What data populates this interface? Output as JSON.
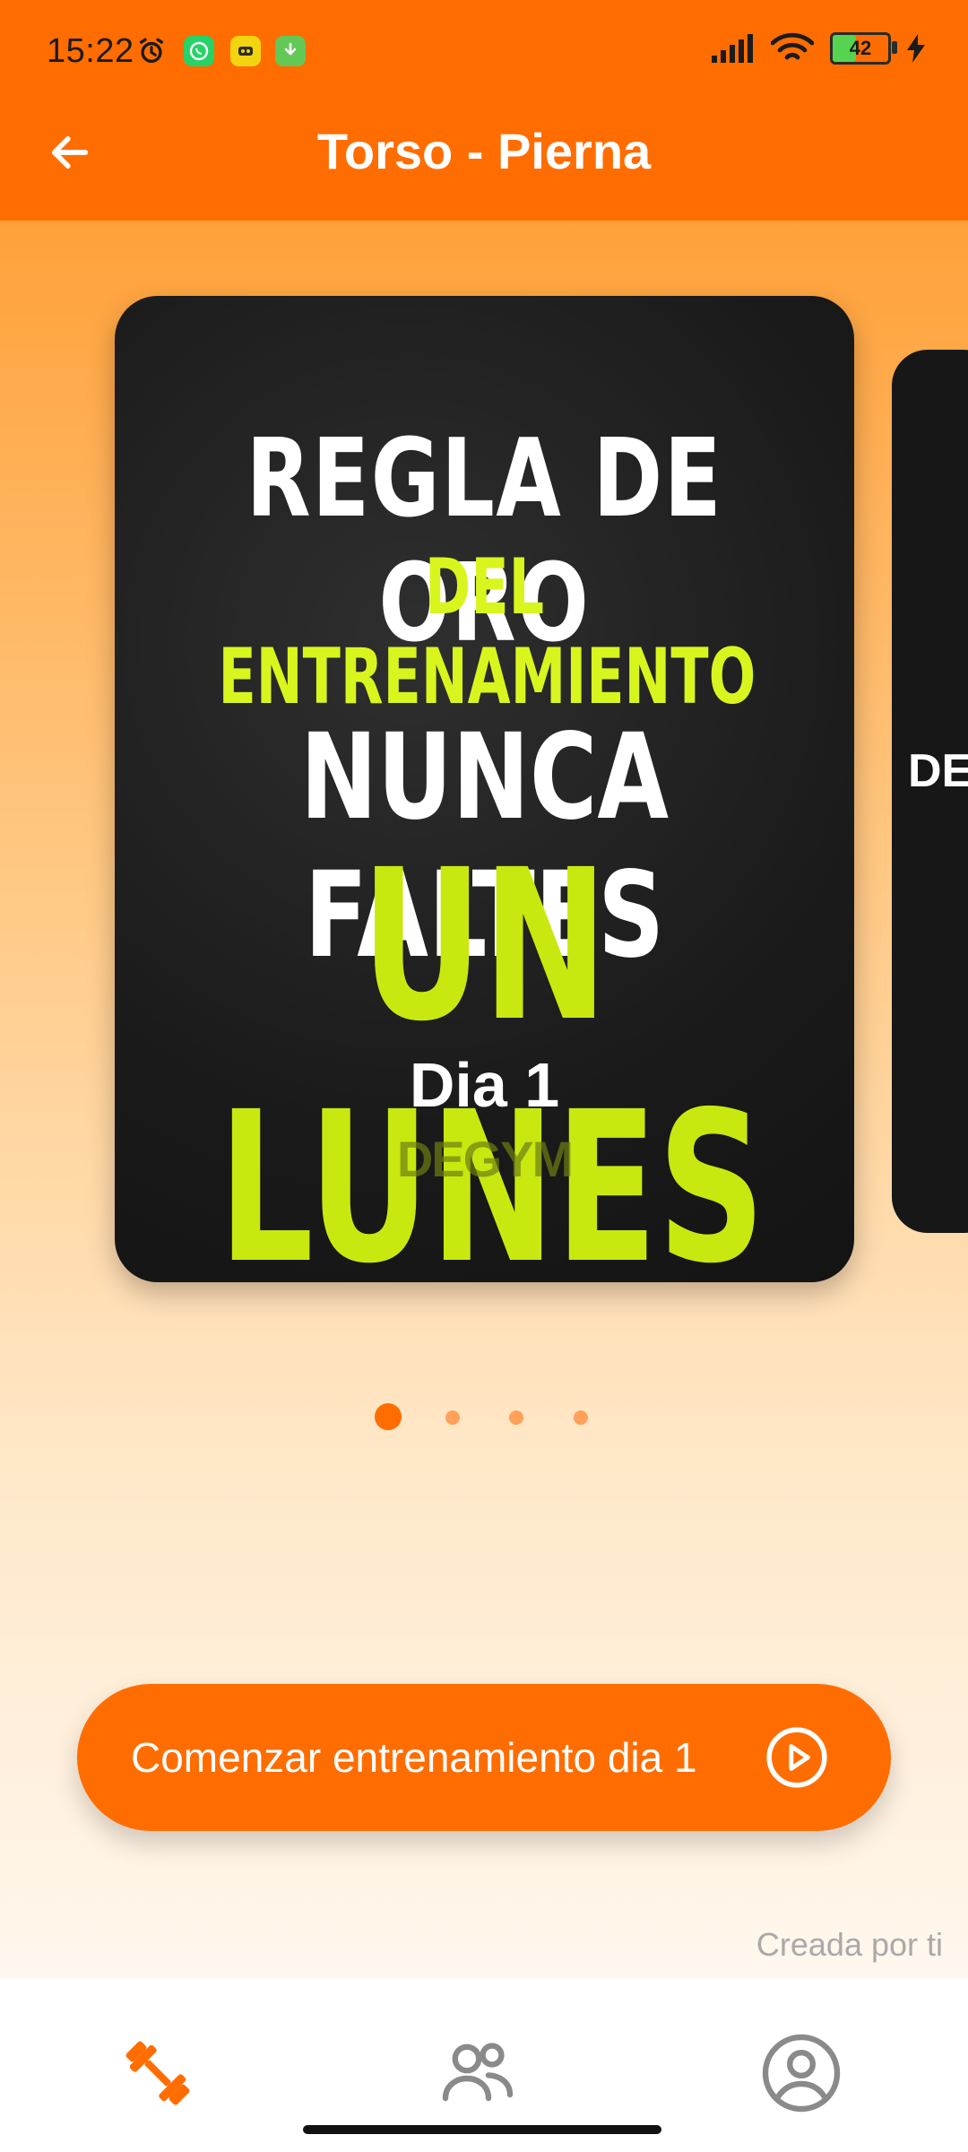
{
  "status_bar": {
    "time": "15:22",
    "battery_level": "42",
    "notifications": [
      "alarm-icon",
      "whatsapp-icon",
      "app-icon",
      "download-icon"
    ]
  },
  "header": {
    "title": "Torso - Pierna",
    "back_icon": "arrow-left-icon"
  },
  "carousel": {
    "active_index": 0,
    "page_count": 4,
    "cards": [
      {
        "day_label": "Dia 1",
        "image_text": [
          "REGLA DE ORO",
          "DEL ENTRENAMIENTO",
          "NUNCA FALTES",
          "UN LUNES"
        ],
        "image_brand": "DEGYM"
      },
      {
        "image_text_partial": "DEE"
      }
    ]
  },
  "cta": {
    "label": "Comenzar entrenamiento dia 1",
    "icon": "play-circle-icon"
  },
  "footer_note": "Creada por ti",
  "bottom_nav": {
    "items": [
      {
        "name": "workouts",
        "icon": "dumbbell-icon",
        "active": true
      },
      {
        "name": "community",
        "icon": "users-icon",
        "active": false
      },
      {
        "name": "profile",
        "icon": "user-circle-icon",
        "active": false
      }
    ]
  },
  "colors": {
    "primary": "#FF6D00",
    "gradient_top": "#FFA13A",
    "gradient_bottom": "#FFF7EE",
    "accent_text": "#D9F51E"
  }
}
